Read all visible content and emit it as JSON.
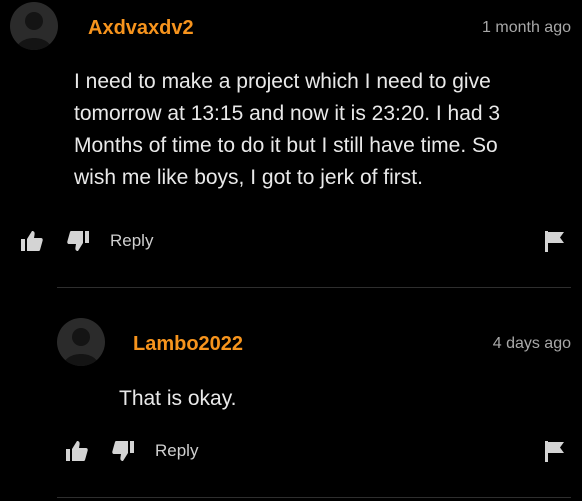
{
  "comments": [
    {
      "username": "Axdvaxdv2",
      "time": "1 month ago",
      "text": "I need to make a project which I need to give\ntomorrow at 13:15 and now it is 23:20. I had 3\nMonths of time to do it but I still have time. So\nwish me like boys, I got to jerk of first.",
      "reply_label": "Reply"
    },
    {
      "username": "Lambo2022",
      "time": "4 days ago",
      "text": "That is okay.",
      "reply_label": "Reply"
    }
  ],
  "colors": {
    "background": "#000000",
    "username": "#f7941d",
    "text": "#e9e9e9",
    "muted": "#a8a8a8",
    "divider": "#2e2e2e"
  },
  "icons": [
    "avatar-placeholder-icon",
    "thumbs-up-icon",
    "thumbs-down-icon",
    "flag-icon"
  ]
}
